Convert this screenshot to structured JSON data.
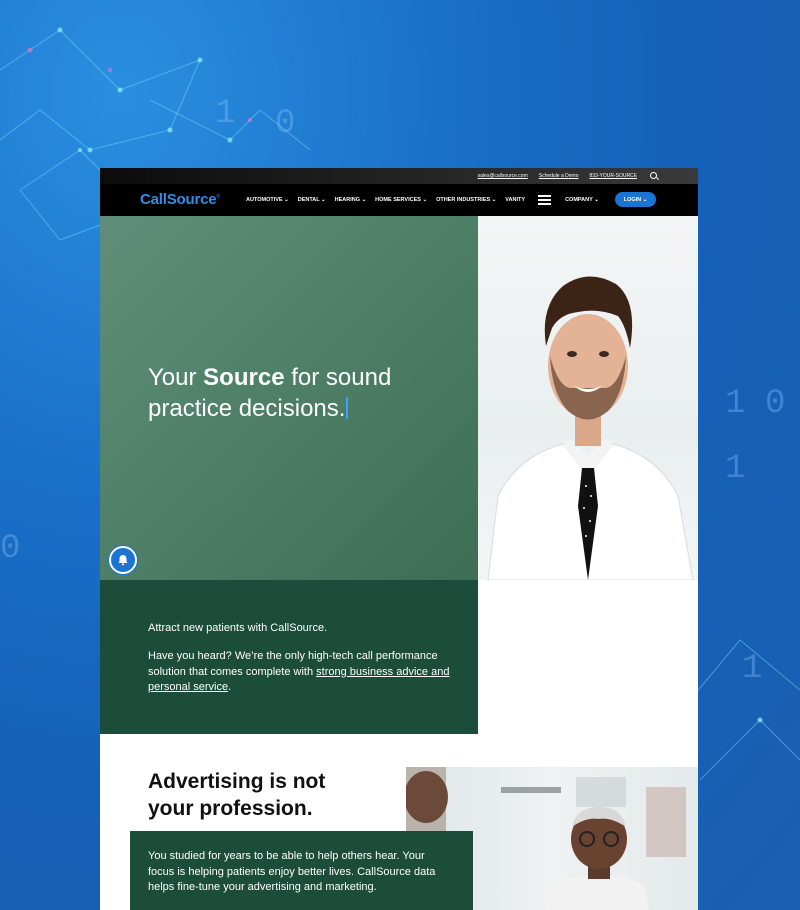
{
  "utility_bar": {
    "email": "sales@callsource.com",
    "schedule": "Schedule a Demo",
    "phone": "833-YOUR-SOURCE"
  },
  "logo": {
    "text": "CallSource",
    "mark": "®"
  },
  "nav": {
    "items": [
      "AUTOMOTIVE",
      "DENTAL",
      "HEARING",
      "HOME SERVICES",
      "OTHER INDUSTRIES",
      "VANITY"
    ],
    "company": "COMPANY",
    "login": "LOGIN",
    "caret": "⌄"
  },
  "hero": {
    "headline_pre": "Your",
    "headline_bold": "Source",
    "headline_post": "for sound practice decisions."
  },
  "attract": {
    "lead": "Attract new patients with CallSource.",
    "body_pre": "Have you heard? We’re the only high-tech call performance solution that comes complete with ",
    "body_link": "strong business advice and personal service",
    "body_post": "."
  },
  "advertising": {
    "title": "Advertising is not your profession.",
    "body": "You studied for years to be able to help others hear. Your focus is helping patients enjoy better lives. CallSource data helps fine-tune your advertising and marketing."
  },
  "background_digits": [
    "1",
    "0",
    "1",
    "0",
    "1",
    "0",
    "1",
    "0",
    "0",
    "1",
    "0"
  ],
  "colors": {
    "brand_blue": "#2e8ee8",
    "login_blue": "#1a74d4",
    "hero_green": "#4f8068",
    "dark_green": "#1b4d3a",
    "background_blue": "#1a6fc8"
  },
  "icons": [
    "search-icon",
    "menu-icon",
    "bell-icon",
    "chevron-down-icon"
  ]
}
